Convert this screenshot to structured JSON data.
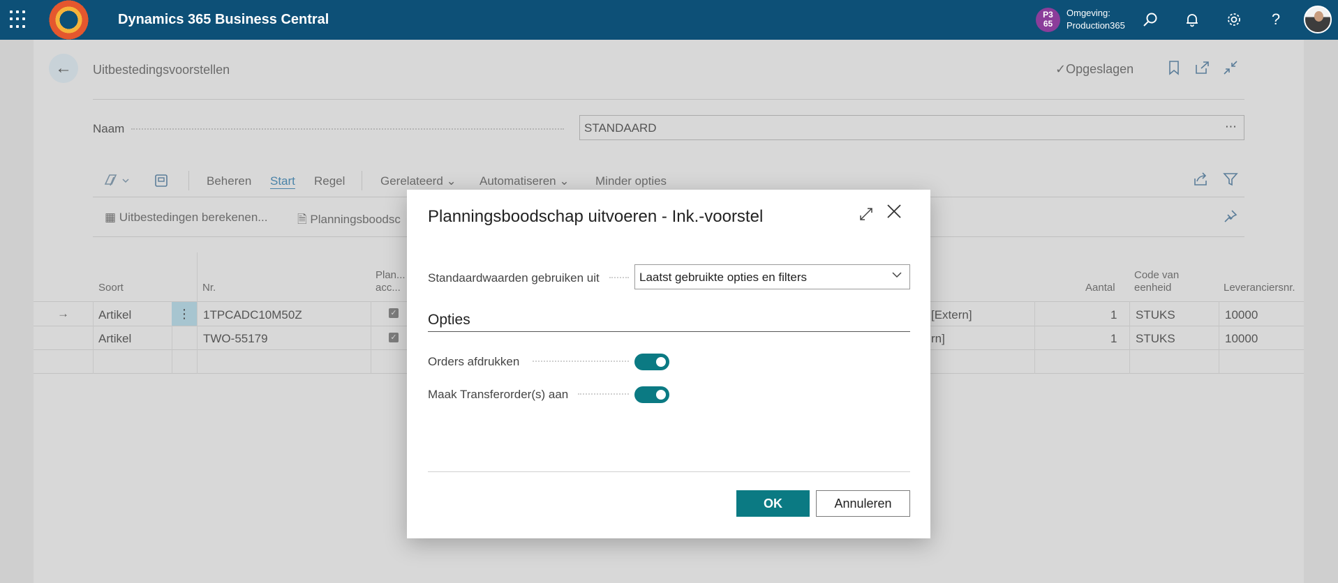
{
  "topbar": {
    "app_title": "Dynamics 365 Business Central",
    "env_badge": "P3 65",
    "env_label": "Omgeving:",
    "env_name": "Production365"
  },
  "page": {
    "title": "Uitbestedingsvoorstellen",
    "saved_status": "Opgeslagen",
    "name_label": "Naam",
    "name_value": "STANDAARD",
    "actions": [
      "Beheren",
      "Start",
      "Regel",
      "Gerelateerd",
      "Automatiseren",
      "Minder opties"
    ],
    "sub_actions": [
      "Uitbestedingen berekenen...",
      "Planningsboodsc"
    ],
    "columns": {
      "soort": "Soort",
      "nr": "Nr.",
      "plan_acc_1": "Plan...",
      "plan_acc_2": "acc...",
      "aantal": "Aantal",
      "code_eenheid_1": "Code van",
      "code_eenheid_2": "eenheid",
      "leveranciersnr": "Leveranciersnr."
    },
    "rows": [
      {
        "soort": "Artikel",
        "nr": "1TPCADC10M50Z",
        "desc_tail": "[Extern]",
        "aantal": "1",
        "eenheid": "STUKS",
        "leverancier": "10000"
      },
      {
        "soort": "Artikel",
        "nr": "TWO-55179",
        "desc_tail": "rn]",
        "aantal": "1",
        "eenheid": "STUKS",
        "leverancier": "10000"
      }
    ]
  },
  "dialog": {
    "title": "Planningsboodschap uitvoeren - Ink.-voorstel",
    "defaults_label": "Standaardwaarden gebruiken uit",
    "defaults_value": "Laatst gebruikte opties en filters",
    "section_title": "Opties",
    "option_print_label": "Orders afdrukken",
    "option_print_on": true,
    "option_transfer_label": "Maak Transferorder(s) aan",
    "option_transfer_on": true,
    "ok_label": "OK",
    "cancel_label": "Annuleren"
  },
  "colors": {
    "topbar": "#0d5077",
    "accent": "#0b7a83",
    "env_badge": "#8b3d9a"
  }
}
